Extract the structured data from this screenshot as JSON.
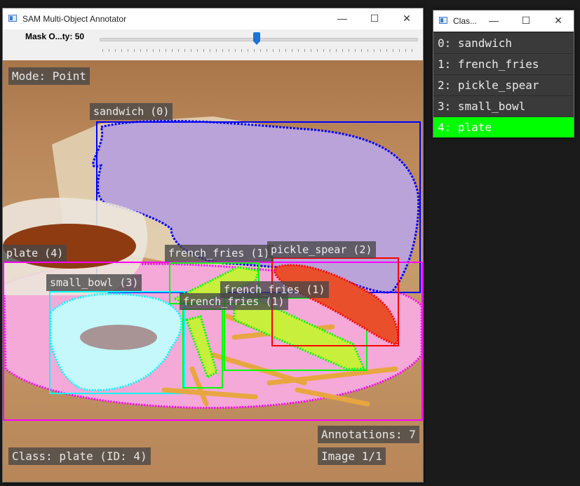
{
  "main_window": {
    "title": "SAM Multi-Object Annotator",
    "controls": {
      "minimize": "—",
      "maximize": "☐",
      "close": "✕"
    },
    "slider": {
      "label": "Mask O...ty: 50",
      "value": 50,
      "max": 100
    },
    "overlay": {
      "mode": "Mode: Point",
      "annotations": "Annotations: 7",
      "class_info": "Class: plate (ID: 4)",
      "image_counter": "Image 1/1"
    },
    "labels": {
      "sandwich": "sandwich (0)",
      "plate": "plate (4)",
      "small_bowl": "small_bowl (3)",
      "fries_a": "french_fries (1)",
      "fries_b": "french_fries (1)",
      "fries_c": "french_fries (1)",
      "pickle": "pickle_spear (2)"
    }
  },
  "classes_window": {
    "title": "Clas...",
    "controls": {
      "minimize": "—",
      "maximize": "☐",
      "close": "✕"
    },
    "items": [
      {
        "label": "0: sandwich",
        "color": "#0000ff"
      },
      {
        "label": "1: french_fries",
        "color": "#00ff00"
      },
      {
        "label": "2: pickle_spear",
        "color": "#ff0000"
      },
      {
        "label": "3: small_bowl",
        "color": "#00ffff"
      },
      {
        "label": "4: plate",
        "color": "#ff00ff"
      }
    ],
    "selected_index": 4
  }
}
